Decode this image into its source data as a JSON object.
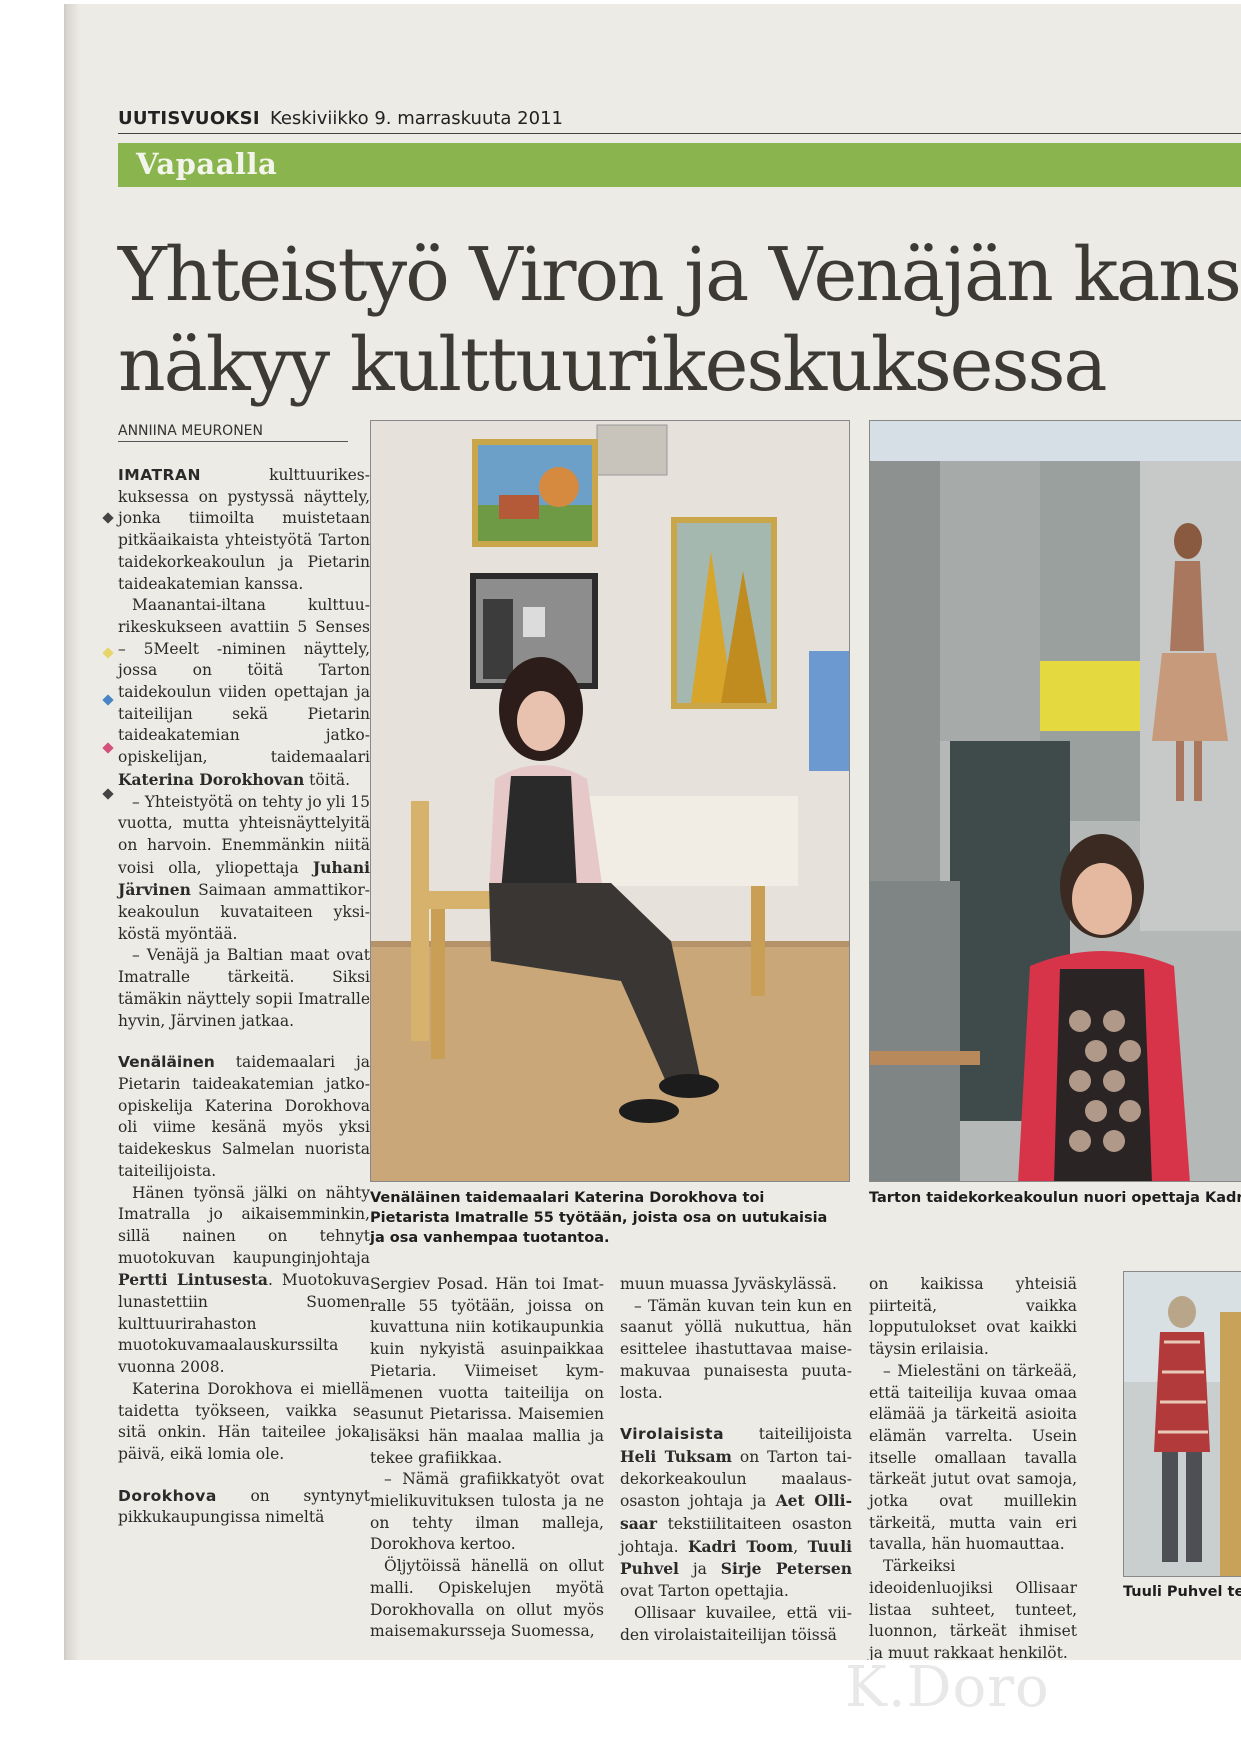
{
  "masthead": {
    "paper_name": "UUTISVUOKSI",
    "date": "Keskiviikko 9. marraskuuta 2011"
  },
  "section": "Vapaalla",
  "headline": {
    "line1": "Yhteistyö Viron ja Venäjän kans",
    "line2": "näkyy kulttuurikeskuksessa"
  },
  "byline": "ANNIINA MEURONEN",
  "column1": {
    "p1_lead": "IMATRAN",
    "p1_text": " kulttuurikes­kuksessa on pystyssä näyt­tely, jonka tiimoilta muiste­taan pitkäaikaista yhteistyö­tä Tarton taidekorkeakou­lun ja Pietarin taideakate­mian kanssa.",
    "p2_text": "Maanantai-iltana kulttuu­rikeskukseen avattiin 5 Sen­ses – 5Meelt -niminen näyt­tely, jossa on töitä Tarton taidekoulun viiden opetta­jan ja taiteilijan sekä Pieta­rin taideakatemian jatko­opiskelijan, taidemaalari ",
    "p2_bold": "Katerina Dorokhovan",
    "p2_end": " töi­tä.",
    "p3_text": "– Yhteistyötä on tehty jo yli 15 vuotta, mutta yhteis­näyttelyitä on harvoin. Enemmänkin niitä voisi ol­la, yliopettaja ",
    "p3_bold": "Juhani Jär­vinen",
    "p3_end": " Saimaan ammattikor­keakoulun kuvataiteen yksi­köstä myöntää.",
    "p4_text": "– Venäjä ja Baltian maat ovat Imatralle tärkeitä. Siksi tämäkin näyttely sopii Imat­ralle hyvin, Järvinen jatkaa.",
    "p5_lead": "Venäläinen",
    "p5_text": " taidemaalari ja Pietarin taideakatemian jat­ko-opiskelija Katerina Do­rokhova oli viime kesänä myös yksi taidekeskus Sal­melan nuorista taiteilijois­ta.",
    "p6_text": "Hänen työnsä jälki on näh­ty Imatralla jo aikaisemmin­kin, sillä nainen on tehnyt muotokuvan kaupunginjoh­taja ",
    "p6_bold": "Pertti Lintusesta",
    "p6_end": ". Muotokuva lunastettiin Suomen kulttuurirahaston muotokuvamaalauskurssil­ta vuonna 2008.",
    "p7_text": "Katerina Dorokhova ei miellä taidetta työkseen, vaikka se sitä onkin. Hän tai­teilee joka päivä, eikä lomia ole.",
    "p8_lead": "Dorokhova",
    "p8_text": " on syntynyt pikkukaupungissa nimeltä"
  },
  "column2": {
    "p1_text": "Sergiev Posad. Hän toi Imat­ralle 55 työtään, joissa on kuvattuna niin kotikaupun­kia kuin nykyistä asuinpaik­kaa Pietaria. Viimeiset kym­menen vuotta taiteilija on asunut Pietarissa. Maise­mien lisäksi hän maalaa mal­lia ja tekee grafiikkaa.",
    "p2_text": "– Nämä grafiikkatyöt ovat mielikuvituksen tulosta ja ne on tehty ilman malleja, Dorokhova kertoo.",
    "p3_text": "Öljytöissä hänellä on ollut malli. Opiskelujen myötä Dorokhovalla on ollut myös maisemakursseja Suomessa,"
  },
  "column3": {
    "p1_text": "muun muassa Jyväskylässä.",
    "p2_text": "– Tämän kuvan tein kun en saanut yöllä nukuttua, hän esittelee ihastuttavaa maise­makuvaa punaisesta puuta­losta.",
    "p3_lead": "Virolaisista",
    "p3_text": " taiteilijoista ",
    "p3_bold1": "Heli Tuksam",
    "p3_mid1": " on Tarton tai­dekorkeakoulun maalaus­osaston johtaja ja ",
    "p3_bold2": "Aet Olli­saar",
    "p3_mid2": " tekstiilitaiteen osaston johtaja. ",
    "p3_bold3": "Kadri Toom",
    "p3_comma": ", ",
    "p3_bold4": "Tuuli Puhvel",
    "p3_ja": " ja ",
    "p3_bold5": "Sirje Petersen",
    "p3_end": " ovat Tarton opettajia.",
    "p4_text": "Ollisaar kuvailee, että vii­den virolaistaiteilijan töissä"
  },
  "column4": {
    "p1_text": "on kaikissa yhteisiä piirteitä, vaikka lopputulokset ovat kaikki täysin erilaisia.",
    "p2_text": "– Mielestäni on tärkeää, et­tä taiteilija kuvaa omaa elä­mää ja tärkeitä asioita elä­män varrelta. Usein itselle omallaan tavalla tärkeät ju­tut ovat samoja, jotka ovat muillekin tärkeitä, mutta vain eri tavalla, hän huo­mauttaa.",
    "p3_text": "Tärkeiksi ideoidenluojiksi Ollisaar listaa suhteet, tun­teet, luonnon, tärkeät ihmi­set ja muut rakkaat henki­löt."
  },
  "captions": {
    "photo1": "Venäläinen taidemaalari Katerina Dorokhova toi Pietarista Imatralle 55 työtään, joista osa on uutukaisia ja osa vanhempaa tuotantoa.",
    "photo2": "Tarton taidekorkeakoulun nuori opettaja Kadri T näyttelyyn töitä, joissa on pysäytetty hetkI.",
    "photo3": "Tuuli Puhvel tek tarpeettomaksi materiaalista."
  },
  "watermark": "K.Doro",
  "colors": {
    "section_bar": "#8ab54e",
    "paper": "#ecebe5",
    "headline": "#3c3a33"
  }
}
